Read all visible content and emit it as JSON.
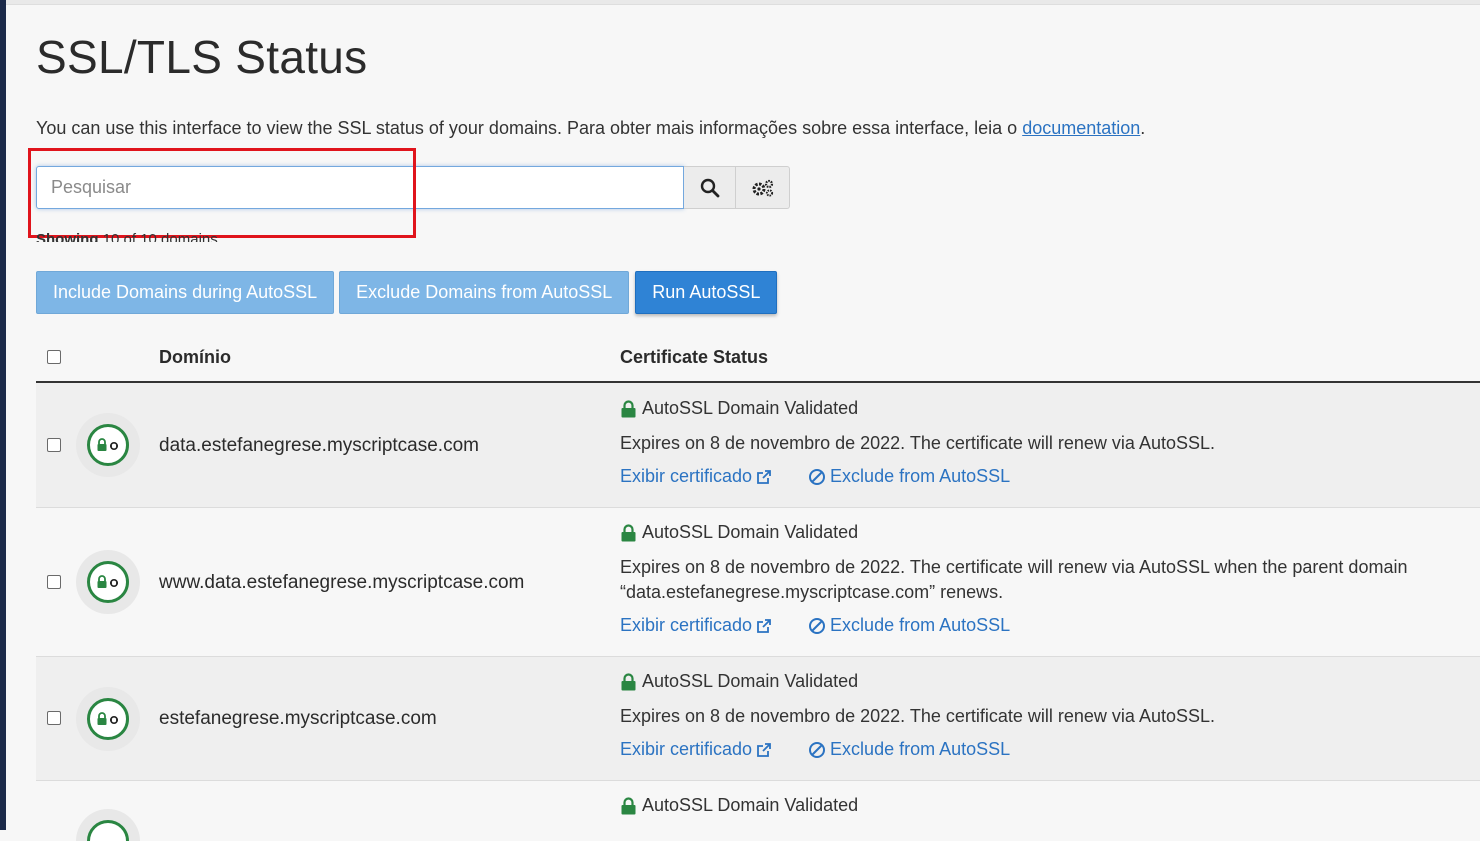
{
  "page": {
    "title": "SSL/TLS Status",
    "intro_text": "You can use this interface to view the SSL status of your domains. Para obter mais informações sobre essa interface, leia o ",
    "doc_link": "documentation",
    "intro_end": "."
  },
  "search": {
    "placeholder": "Pesquisar",
    "value": ""
  },
  "showing": {
    "label": "Showing",
    "text": "10 of 10 domains"
  },
  "actions": {
    "include": "Include Domains during AutoSSL",
    "exclude": "Exclude Domains from AutoSSL",
    "run": "Run AutoSSL"
  },
  "table": {
    "col_domain": "Domínio",
    "col_status": "Certificate Status",
    "rows": [
      {
        "domain": "data.estefanegrese.myscriptcase.com",
        "status": "AutoSSL Domain Validated",
        "desc": "Expires on 8 de novembro de 2022. The certificate will renew via AutoSSL.",
        "view_cert": "Exibir certificado",
        "exclude": "Exclude from AutoSSL"
      },
      {
        "domain": "www.data.estefanegrese.myscriptcase.com",
        "status": "AutoSSL Domain Validated",
        "desc": "Expires on 8 de novembro de 2022. The certificate will renew via AutoSSL when the parent domain “data.estefanegrese.myscriptcase.com” renews.",
        "view_cert": "Exibir certificado",
        "exclude": "Exclude from AutoSSL"
      },
      {
        "domain": "estefanegrese.myscriptcase.com",
        "status": "AutoSSL Domain Validated",
        "desc": "Expires on 8 de novembro de 2022. The certificate will renew via AutoSSL.",
        "view_cert": "Exibir certificado",
        "exclude": "Exclude from AutoSSL"
      },
      {
        "domain": "",
        "status": "AutoSSL Domain Validated"
      }
    ]
  },
  "colors": {
    "link": "#2b73c2",
    "primary": "#2f83d5",
    "light_button": "#7eb6e6",
    "valid_green": "#2a8642",
    "highlight": "#e0141c"
  }
}
